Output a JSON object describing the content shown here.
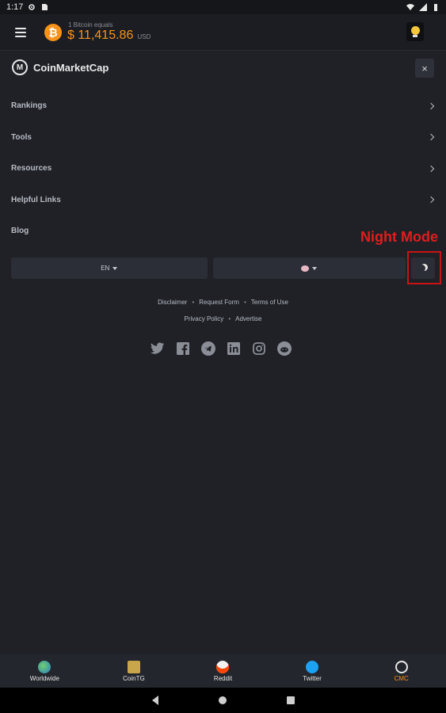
{
  "status_bar": {
    "time": "1:17"
  },
  "header": {
    "price_caption": "1 Bitcoin equals",
    "price": "$ 11,415.86",
    "price_unit": "USD"
  },
  "brand": {
    "name": "CoinMarketCap",
    "close_label": "×"
  },
  "menu": {
    "items": [
      {
        "label": "Rankings",
        "has_chevron": true
      },
      {
        "label": "Tools",
        "has_chevron": true
      },
      {
        "label": "Resources",
        "has_chevron": true
      },
      {
        "label": "Helpful Links",
        "has_chevron": true
      },
      {
        "label": "Blog",
        "has_chevron": false
      }
    ]
  },
  "controls": {
    "language": "EN"
  },
  "annotation": {
    "label": "Night Mode",
    "color": "#e11d1d"
  },
  "footer_links": {
    "row1": [
      "Disclaimer",
      "Request Form",
      "Terms of Use"
    ],
    "row2": [
      "Privacy Policy",
      "Advertise"
    ],
    "separator": "•"
  },
  "socials": [
    "twitter-icon",
    "facebook-icon",
    "telegram-icon",
    "linkedin-icon",
    "instagram-icon",
    "reddit-icon"
  ],
  "bottom_nav": {
    "items": [
      {
        "label": "Worldwide",
        "icon": "globe-icon",
        "active": false
      },
      {
        "label": "CoinTG",
        "icon": "cointg-icon",
        "active": false
      },
      {
        "label": "Reddit",
        "icon": "reddit-icon",
        "active": false
      },
      {
        "label": "Twitter",
        "icon": "twitter-icon",
        "active": false
      },
      {
        "label": "CMC",
        "icon": "cmc-icon",
        "active": true
      }
    ]
  },
  "colors": {
    "accent": "#f7931a",
    "background": "#1f2127"
  }
}
